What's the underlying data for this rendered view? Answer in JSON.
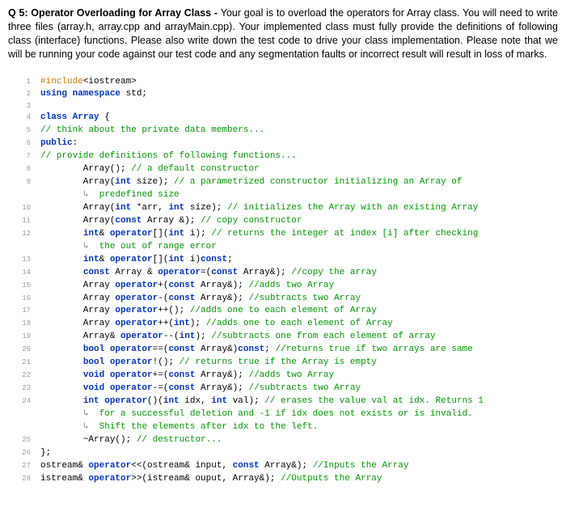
{
  "question": {
    "label": "Q 5: Operator Overloading for Array Class - ",
    "body": "Your goal is to overload the operators for Array class. You will need to write three files (array.h, array.cpp and arrayMain.cpp). Your implemented class must fully provide the definitions of following class (interface) functions. Please also write down the test code to drive your class implementation. Please note that we will be running your code against our test code and any segmentation faults or incorrect result will result in loss of marks."
  },
  "code": {
    "lines": [
      {
        "n": "1",
        "html": "<span class='pp'>#include</span>&lt;iostream&gt;"
      },
      {
        "n": "2",
        "html": "<span class='kw'>using namespace</span> std;"
      },
      {
        "n": "3",
        "html": ""
      },
      {
        "n": "4",
        "html": "<span class='kw'>class</span> <span class='kw'>Array</span> {"
      },
      {
        "n": "5",
        "html": "<span class='cm'>// think about the private data members...</span>"
      },
      {
        "n": "6",
        "html": "<span class='kw'>public</span>:"
      },
      {
        "n": "7",
        "html": "<span class='cm'>// provide definitions of following functions...</span>"
      },
      {
        "n": "8",
        "html": "        Array(); <span class='cm'>// a default constructor</span>"
      },
      {
        "n": "9",
        "html": "        Array(<span class='kw'>int</span> size); <span class='cm'>// a parametrized constructor initializing an Array of</span>"
      },
      {
        "n": "",
        "cont": true,
        "html": "        <span class='arrow'>↳</span>  <span class='cm'>predefined size</span>"
      },
      {
        "n": "10",
        "html": "        Array(<span class='kw'>int</span> *arr, <span class='kw'>int</span> size); <span class='cm'>// initializes the Array with an existing Array</span>"
      },
      {
        "n": "11",
        "html": "        Array(<span class='kw'>const</span> Array &amp;); <span class='cm'>// copy constructor</span>"
      },
      {
        "n": "12",
        "html": "        <span class='kw'>int</span>&amp; <span class='kw'>operator</span>[](<span class='kw'>int</span> i); <span class='cm'>// returns the integer at index [i] after checking</span>"
      },
      {
        "n": "",
        "cont": true,
        "html": "        <span class='arrow'>↳</span>  <span class='cm'>the out of range error</span>"
      },
      {
        "n": "13",
        "html": "        <span class='kw'>int</span>&amp; <span class='kw'>operator</span>[](<span class='kw'>int</span> i)<span class='kw'>const</span>;"
      },
      {
        "n": "14",
        "html": "        <span class='kw'>const</span> Array &amp; <span class='kw'>operator</span>=(<span class='kw'>const</span> Array&amp;); <span class='cm'>//copy the array</span>"
      },
      {
        "n": "15",
        "html": "        Array <span class='kw'>operator</span>+(<span class='kw'>const</span> Array&amp;); <span class='cm'>//adds two Array</span>"
      },
      {
        "n": "16",
        "html": "        Array <span class='kw'>operator</span>-(<span class='kw'>const</span> Array&amp;); <span class='cm'>//subtracts two Array</span>"
      },
      {
        "n": "17",
        "html": "        Array <span class='kw'>operator</span>++(); <span class='cm'>//adds one to each element of Array</span>"
      },
      {
        "n": "18",
        "html": "        Array <span class='kw'>operator</span>++(<span class='kw'>int</span>); <span class='cm'>//adds one to each element of Array</span>"
      },
      {
        "n": "19",
        "html": "        Array&amp; <span class='kw'>operator</span>--(<span class='kw'>int</span>); <span class='cm'>//subtracts one from each element of array</span>"
      },
      {
        "n": "20",
        "html": "        <span class='kw'>bool</span> <span class='kw'>operator</span>==(<span class='kw'>const</span> Array&amp;)<span class='kw'>const</span>; <span class='cm'>//returns true if two arrays are same</span>"
      },
      {
        "n": "21",
        "html": "        <span class='kw'>bool</span> <span class='kw'>operator</span>!(); <span class='cm'>// returns true if the Array is empty</span>"
      },
      {
        "n": "22",
        "html": "        <span class='kw'>void</span> <span class='kw'>operator</span>+=(<span class='kw'>const</span> Array&amp;); <span class='cm'>//adds two Array</span>"
      },
      {
        "n": "23",
        "html": "        <span class='kw'>void</span> <span class='kw'>operator</span>-=(<span class='kw'>const</span> Array&amp;); <span class='cm'>//subtracts two Array</span>"
      },
      {
        "n": "24",
        "html": "        <span class='kw'>int</span> <span class='kw'>operator</span>()(<span class='kw'>int</span> idx, <span class='kw'>int</span> val); <span class='cm'>// erases the value val at idx. Returns 1</span>"
      },
      {
        "n": "",
        "cont": true,
        "html": "        <span class='arrow'>↳</span>  <span class='cm'>for a successful deletion and -1 if idx does not exists or is invalid.</span>"
      },
      {
        "n": "",
        "cont": true,
        "html": "        <span class='arrow'>↳</span>  <span class='cm'>Shift the elements after idx to the left.</span>"
      },
      {
        "n": "25",
        "html": "        ~Array(); <span class='cm'>// destructor...</span>"
      },
      {
        "n": "26",
        "html": "};"
      },
      {
        "n": "27",
        "html": "ostream&amp; <span class='kw'>operator</span>&lt;&lt;(ostream&amp; input, <span class='kw'>const</span> Array&amp;); <span class='cm'>//Inputs the Array</span>"
      },
      {
        "n": "28",
        "html": "istream&amp; <span class='kw'>operator</span>&gt;&gt;(istream&amp; ouput, Array&amp;); <span class='cm'>//Outputs the Array</span>"
      }
    ]
  }
}
